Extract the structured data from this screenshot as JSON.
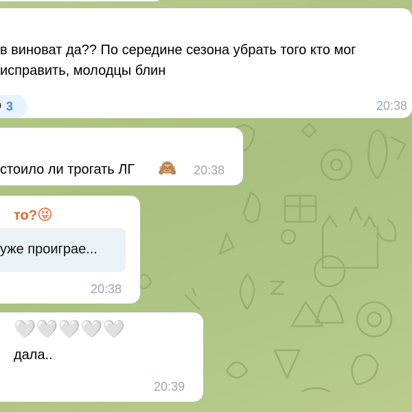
{
  "chat": {
    "messages": [
      {
        "line1": "в виноват да?? По середине сезона убрать того кто мог",
        "line2": "исправить, молодцы блин",
        "reaction": {
          "emoji": "😢",
          "count": "3"
        },
        "time": "20:38"
      },
      {
        "text": "стоило ли трогать ЛГ",
        "emoji": "🙈",
        "time": "20:38"
      },
      {
        "sender_fragment": "то?",
        "sender_emoji": "😝",
        "reply_preview": "уже проиграе...",
        "time": "20:38"
      },
      {
        "hearts": "🤍🤍🤍🤍🤍",
        "text": "дала..",
        "time": "20:39"
      }
    ]
  },
  "colors": {
    "background": "#b7c98b",
    "bubble": "#ffffff",
    "time": "#9aa6ad",
    "sender": "#e1662a",
    "reaction_count": "#3a8fd6"
  }
}
